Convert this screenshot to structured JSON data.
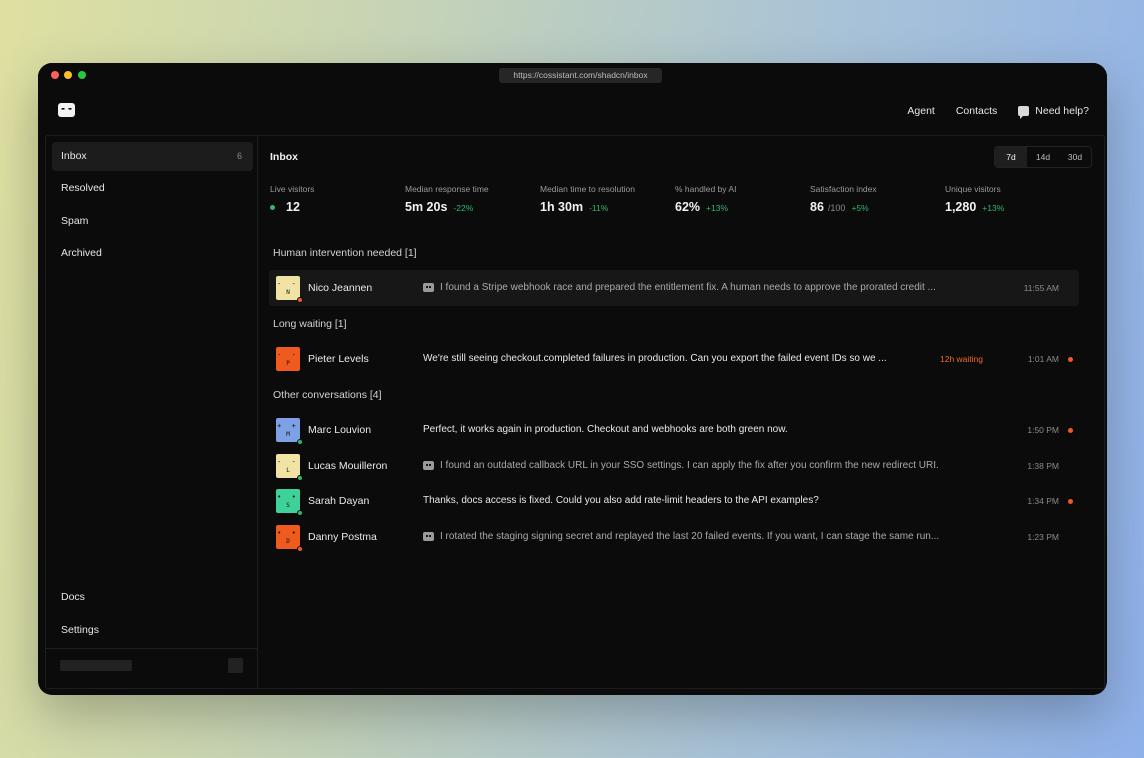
{
  "browser": {
    "url": "https://cossistant.com/shadcn/inbox"
  },
  "topnav": {
    "agent": "Agent",
    "contacts": "Contacts",
    "help": "Need help?"
  },
  "sidebar": {
    "items": [
      {
        "label": "Inbox",
        "count": "6",
        "active": true
      },
      {
        "label": "Resolved"
      },
      {
        "label": "Spam"
      },
      {
        "label": "Archived"
      }
    ],
    "footer": [
      {
        "label": "Docs"
      },
      {
        "label": "Settings"
      }
    ]
  },
  "main": {
    "title": "Inbox",
    "ranges": [
      {
        "label": "7d",
        "active": true
      },
      {
        "label": "14d"
      },
      {
        "label": "30d"
      }
    ],
    "stats": [
      {
        "label": "Live visitors",
        "value": "12",
        "live": true
      },
      {
        "label": "Median response time",
        "value": "5m 20s",
        "delta": "-22%"
      },
      {
        "label": "Median time to resolution",
        "value": "1h 30m",
        "delta": "-11%"
      },
      {
        "label": "% handled by AI",
        "value": "62%",
        "delta": "+13%"
      },
      {
        "label": "Satisfaction index",
        "value": "86",
        "sub": "/100",
        "delta": "+5%"
      },
      {
        "label": "Unique visitors",
        "value": "1,280",
        "delta": "+13%"
      }
    ],
    "sections": [
      {
        "title": "Human intervention needed [1]",
        "conversations": [
          {
            "name": "Nico Jeannen",
            "initial": "N",
            "eyes": "- -",
            "avatar_color": "#f0e3a3",
            "status_color": "#ef5a24",
            "ai": true,
            "message": "I found a Stripe webhook race and prepared the entitlement fix. A human needs to approve the prorated credit ...",
            "time": "11:55 AM",
            "unread": false,
            "highlight": true
          }
        ]
      },
      {
        "title": "Long waiting [1]",
        "conversations": [
          {
            "name": "Pieter Levels",
            "initial": "P",
            "eyes": "- -",
            "avatar_color": "#ef5a1f",
            "ai": false,
            "message": "We're still seeing checkout.completed failures in production. Can you export the failed event IDs so we ...",
            "waiting": "12h waiting",
            "time": "1:01 AM",
            "unread": true
          }
        ]
      },
      {
        "title": "Other conversations [4]",
        "conversations": [
          {
            "name": "Marc Louvion",
            "initial": "M",
            "eyes": "+ +",
            "avatar_color": "#7ea1e6",
            "status_color": "#2fb86c",
            "ai": false,
            "message": "Perfect, it works again in production. Checkout and webhooks are both green now.",
            "time": "1:50 PM",
            "unread": true
          },
          {
            "name": "Lucas Mouilleron",
            "initial": "L",
            "eyes": "- -",
            "avatar_color": "#f0e3a3",
            "status_color": "#2fb86c",
            "ai": true,
            "message": "I found an outdated callback URL in your SSO settings. I can apply the fix after you confirm the new redirect URI.",
            "time": "1:38 PM",
            "unread": false
          },
          {
            "name": "Sarah Dayan",
            "initial": "S",
            "eyes": "• •",
            "avatar_color": "#3fd19a",
            "status_color": "#2fb86c",
            "ai": false,
            "message": "Thanks, docs access is fixed. Could you also add rate-limit headers to the API examples?",
            "time": "1:34 PM",
            "unread": true
          },
          {
            "name": "Danny Postma",
            "initial": "D",
            "eyes": "• •",
            "avatar_color": "#ef5a1f",
            "status_color": "#ef5a24",
            "ai": true,
            "message": "I rotated the staging signing secret and replayed the last 20 failed events. If you want, I can stage the same run...",
            "time": "1:23 PM",
            "unread": false
          }
        ]
      }
    ]
  }
}
